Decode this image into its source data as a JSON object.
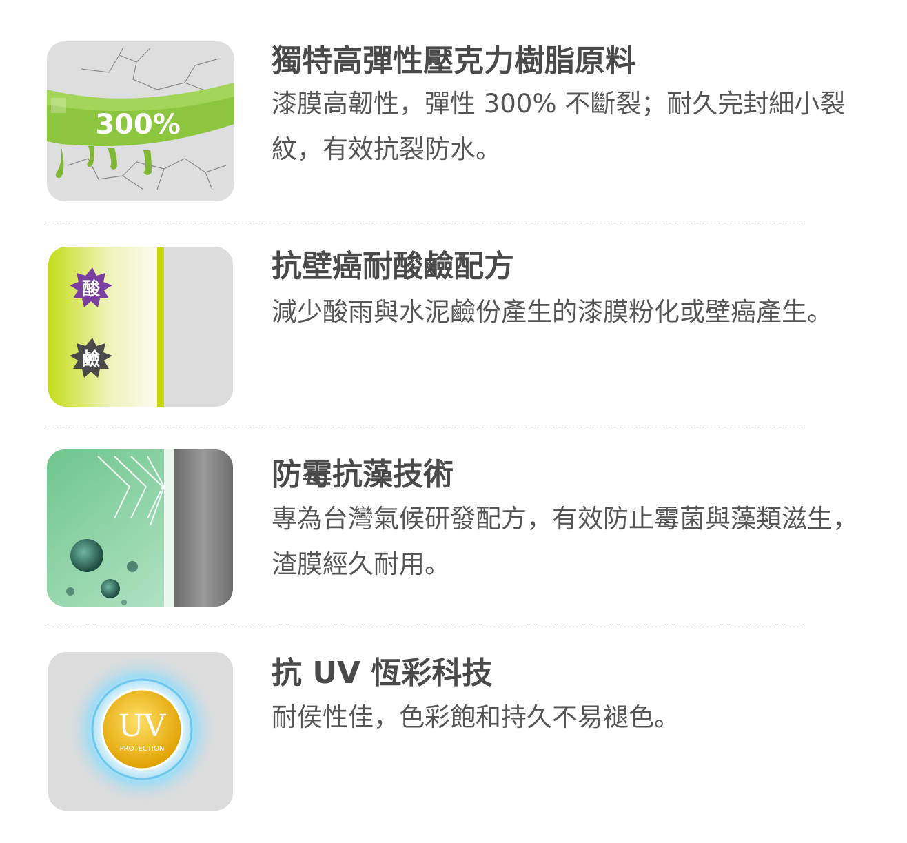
{
  "features": [
    {
      "title": "獨特高彈性壓克力樹脂原料",
      "description": "漆膜高韌性，彈性 300% 不斷裂；耐久完封細小裂紋，有效抗裂防水。",
      "image_label": "300%",
      "icon": "elastic-crack-icon",
      "accent_color": "#8bc34a"
    },
    {
      "title": "抗壁癌耐酸鹼配方",
      "description": "減少酸雨與水泥鹼份產生的漆膜粉化或壁癌產生。",
      "image_labels": [
        "酸",
        "鹼"
      ],
      "icon": "acid-alkali-icon",
      "accent_color": "#c5d80a"
    },
    {
      "title": "防霉抗藻技術",
      "description": "專為台灣氣候研發配方，有效防止霉菌與藻類滋生，渣膜經久耐用。",
      "icon": "anti-mold-icon",
      "accent_color": "#6fca8a"
    },
    {
      "title": "抗 UV 恆彩科技",
      "description": "耐侯性佳，色彩飽和持久不易褪色。",
      "image_label": "UV",
      "image_sublabel": "PROTECTION",
      "icon": "uv-protection-icon",
      "accent_color": "#f0b800"
    }
  ]
}
